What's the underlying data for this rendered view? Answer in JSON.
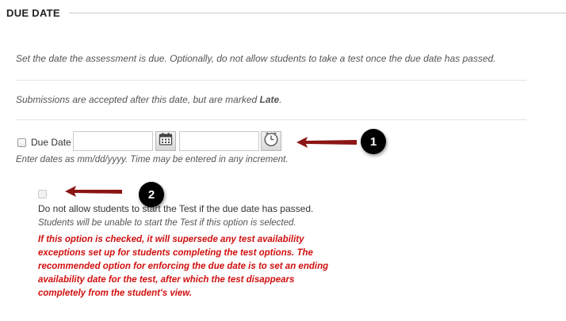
{
  "section": {
    "title": "DUE DATE"
  },
  "intro": "Set the date the assessment is due. Optionally, do not allow students to take a test once the due date has passed.",
  "late_note": {
    "prefix": "Submissions are accepted after this date, but are marked ",
    "emphasis": "Late",
    "suffix": "."
  },
  "due_date": {
    "label": "Due Date",
    "date_value": "",
    "time_value": "",
    "hint": "Enter dates as mm/dd/yyyy. Time may be entered in any increment.",
    "date_picker_icon": "calendar-icon",
    "time_picker_icon": "clock-icon"
  },
  "no_start": {
    "label": "Do not allow students to start the Test if the due date has passed.",
    "hint": "Students will be unable to start the Test if this option is selected.",
    "warning": "If this option is checked, it will supersede any test availability exceptions set up for students completing the test options. The recommended option for enforcing the due date is to set an ending availability date for the test, after which the test disappears completely from the student's view."
  },
  "callouts": [
    {
      "number": "1"
    },
    {
      "number": "2"
    }
  ],
  "colors": {
    "arrow": "#8b1515",
    "warning_text": "#d10f0f",
    "badge": "#000000"
  }
}
